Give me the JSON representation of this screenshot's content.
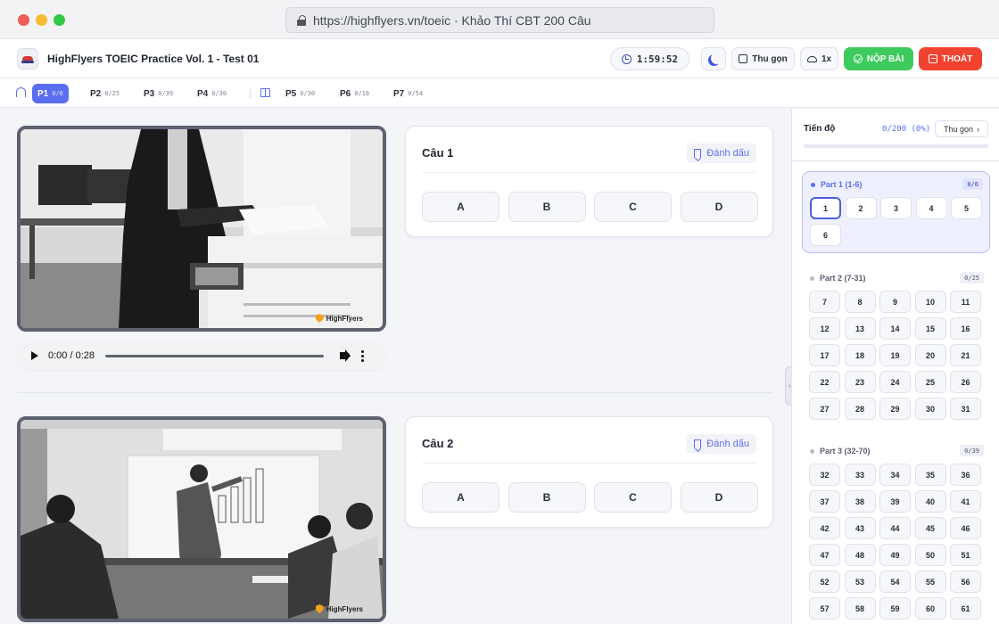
{
  "browser": {
    "url": "https://highflyers.vn/toeic · Khảo Thí CBT 200 Câu"
  },
  "header": {
    "title": "HighFlyers TOEIC Practice Vol. 1 - Test 01",
    "timer": "1:59:52",
    "collapse_label": "Thu gọn",
    "speed_label": "1x",
    "submit_label": "NỘP BÀI",
    "exit_label": "THOÁT"
  },
  "tabs": [
    {
      "label": "P1",
      "count": "0/6",
      "active": true
    },
    {
      "label": "P2",
      "count": "0/25"
    },
    {
      "label": "P3",
      "count": "0/39"
    },
    {
      "label": "P4",
      "count": "0/30"
    },
    {
      "label": "P5",
      "count": "0/30"
    },
    {
      "label": "P6",
      "count": "0/16"
    },
    {
      "label": "P7",
      "count": "0/54"
    }
  ],
  "audio": {
    "time": "0:00 / 0:28"
  },
  "watermark": "HighFlyers",
  "questions": [
    {
      "title": "Câu 1",
      "mark_label": "Đánh dấu",
      "options": [
        "A",
        "B",
        "C",
        "D"
      ]
    },
    {
      "title": "Câu 2",
      "mark_label": "Đánh dấu",
      "options": [
        "A",
        "B",
        "C",
        "D"
      ]
    }
  ],
  "sidebar": {
    "progress_label": "Tiến độ",
    "progress_value": "0/200 (0%)",
    "progress_fraction": 0,
    "collapse_label": "Thu gọn",
    "parts": [
      {
        "name": "Part 1 (1-6)",
        "count": "0/6",
        "numbers": [
          "1",
          "2",
          "3",
          "4",
          "5",
          "6"
        ],
        "current": "1",
        "active": true
      },
      {
        "name": "Part 2 (7-31)",
        "count": "0/25",
        "numbers": [
          "7",
          "8",
          "9",
          "10",
          "11",
          "12",
          "13",
          "14",
          "15",
          "16",
          "17",
          "18",
          "19",
          "20",
          "21",
          "22",
          "23",
          "24",
          "25",
          "26",
          "27",
          "28",
          "29",
          "30",
          "31"
        ]
      },
      {
        "name": "Part 3 (32-70)",
        "count": "0/39",
        "numbers": [
          "32",
          "33",
          "34",
          "35",
          "36",
          "37",
          "38",
          "39",
          "40",
          "41",
          "42",
          "43",
          "44",
          "45",
          "46",
          "47",
          "48",
          "49",
          "50",
          "51",
          "52",
          "53",
          "54",
          "55",
          "56",
          "57",
          "58",
          "59",
          "60",
          "61"
        ]
      }
    ]
  },
  "colors": {
    "accent": "#5b6df0",
    "submit": "#3ecb5e",
    "exit": "#f0432f"
  }
}
